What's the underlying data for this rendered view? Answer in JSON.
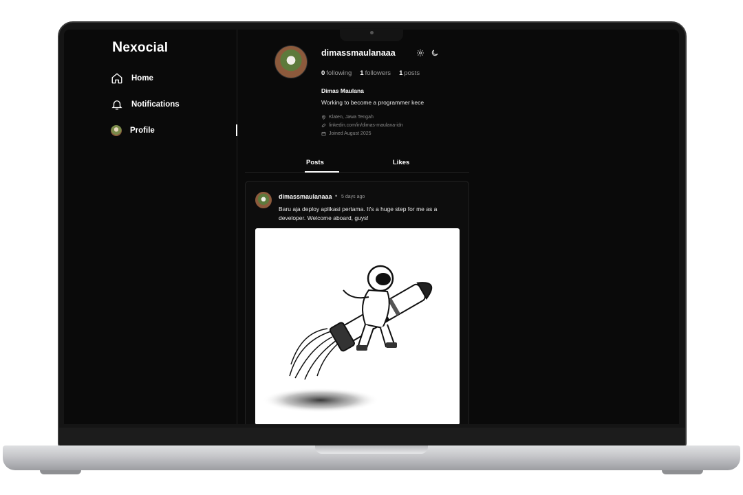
{
  "app": {
    "logo_initial": "N",
    "logo_rest": "exocial"
  },
  "nav": {
    "items": [
      {
        "label": "Home",
        "icon": "home-icon"
      },
      {
        "label": "Notifications",
        "icon": "bell-icon"
      },
      {
        "label": "Profile",
        "icon": "avatar"
      }
    ],
    "active": "Profile"
  },
  "profile": {
    "username": "dimassmaulanaaa",
    "stats": {
      "following_count": "0",
      "following_label": "following",
      "followers_count": "1",
      "followers_label": "followers",
      "posts_count": "1",
      "posts_label": "posts"
    },
    "display_name": "Dimas Maulana",
    "bio": "Working to become a programmer kece",
    "location": "Klaten, Jawa Tengah",
    "website": "linkedin.com/in/dimas-maulana-idn",
    "joined": "Joined August 2025"
  },
  "tabs": [
    {
      "label": "Posts",
      "active": true
    },
    {
      "label": "Likes",
      "active": false
    }
  ],
  "post": {
    "username": "dimassmaulanaaa",
    "separator": "•",
    "time": "5 days ago",
    "text": "Baru aja deploy aplikasi pertama. It's a huge step for me as a developer. Welcome aboard, guys!",
    "image_icon": "astronaut-rocket-illustration"
  },
  "colors": {
    "background": "#0a0a0a",
    "text": "#ffffff",
    "muted": "#9a9a9a",
    "border": "#222222"
  }
}
